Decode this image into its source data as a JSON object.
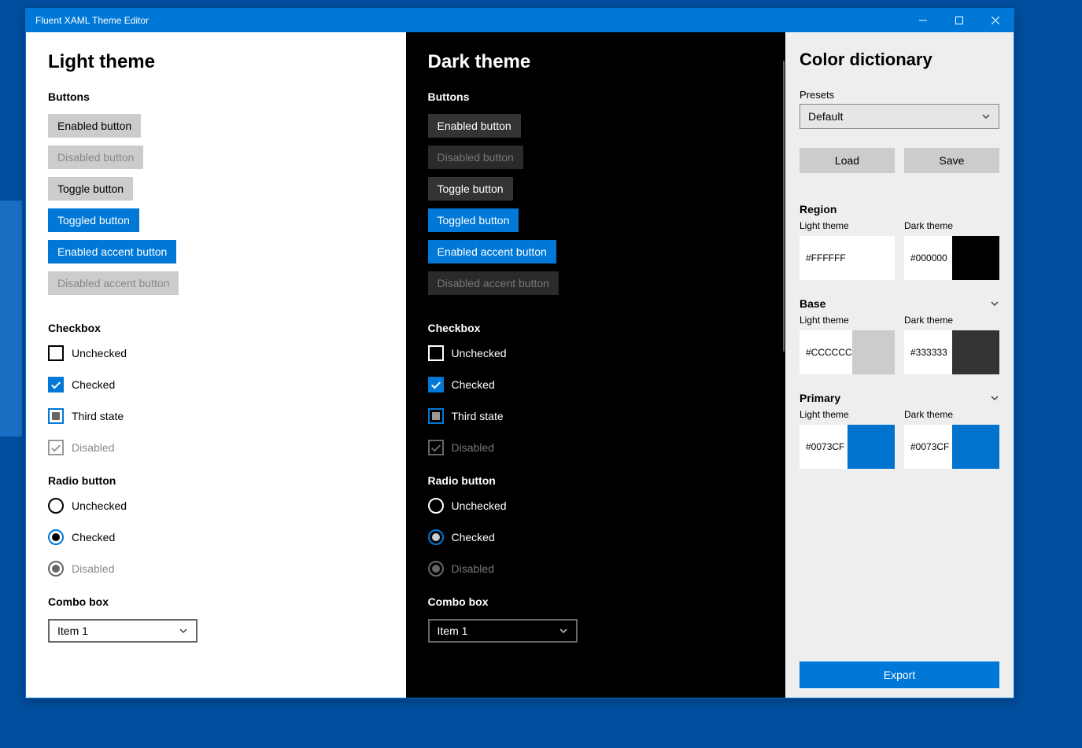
{
  "window": {
    "title": "Fluent XAML Theme Editor"
  },
  "themes": {
    "light": {
      "title": "Light theme"
    },
    "dark": {
      "title": "Dark theme"
    }
  },
  "sections": {
    "buttons": "Buttons",
    "checkbox": "Checkbox",
    "radio": "Radio button",
    "combo": "Combo box"
  },
  "buttons": {
    "enabled": "Enabled button",
    "disabled": "Disabled button",
    "toggle": "Toggle button",
    "toggled": "Toggled button",
    "accent": "Enabled accent button",
    "accent_disabled": "Disabled accent button"
  },
  "checkbox": {
    "unchecked": "Unchecked",
    "checked": "Checked",
    "third": "Third state",
    "disabled": "Disabled"
  },
  "radio": {
    "unchecked": "Unchecked",
    "checked": "Checked",
    "disabled": "Disabled"
  },
  "combo": {
    "selected": "Item 1"
  },
  "side": {
    "title": "Color dictionary",
    "presets_label": "Presets",
    "preset_selected": "Default",
    "load": "Load",
    "save": "Save",
    "region": {
      "heading": "Region",
      "light_label": "Light theme",
      "dark_label": "Dark theme",
      "light": "#FFFFFF",
      "dark": "#000000"
    },
    "base": {
      "heading": "Base",
      "light_label": "Light theme",
      "dark_label": "Dark theme",
      "light": "#CCCCCC",
      "dark": "#333333"
    },
    "primary": {
      "heading": "Primary",
      "light_label": "Light theme",
      "dark_label": "Dark theme",
      "light": "#0073CF",
      "dark": "#0073CF"
    },
    "export": "Export"
  },
  "colors": {
    "accent": "#0078d7",
    "region_light": "#FFFFFF",
    "region_dark": "#000000",
    "base_light": "#CCCCCC",
    "base_dark": "#333333",
    "primary_light": "#0073CF",
    "primary_dark": "#0073CF"
  }
}
